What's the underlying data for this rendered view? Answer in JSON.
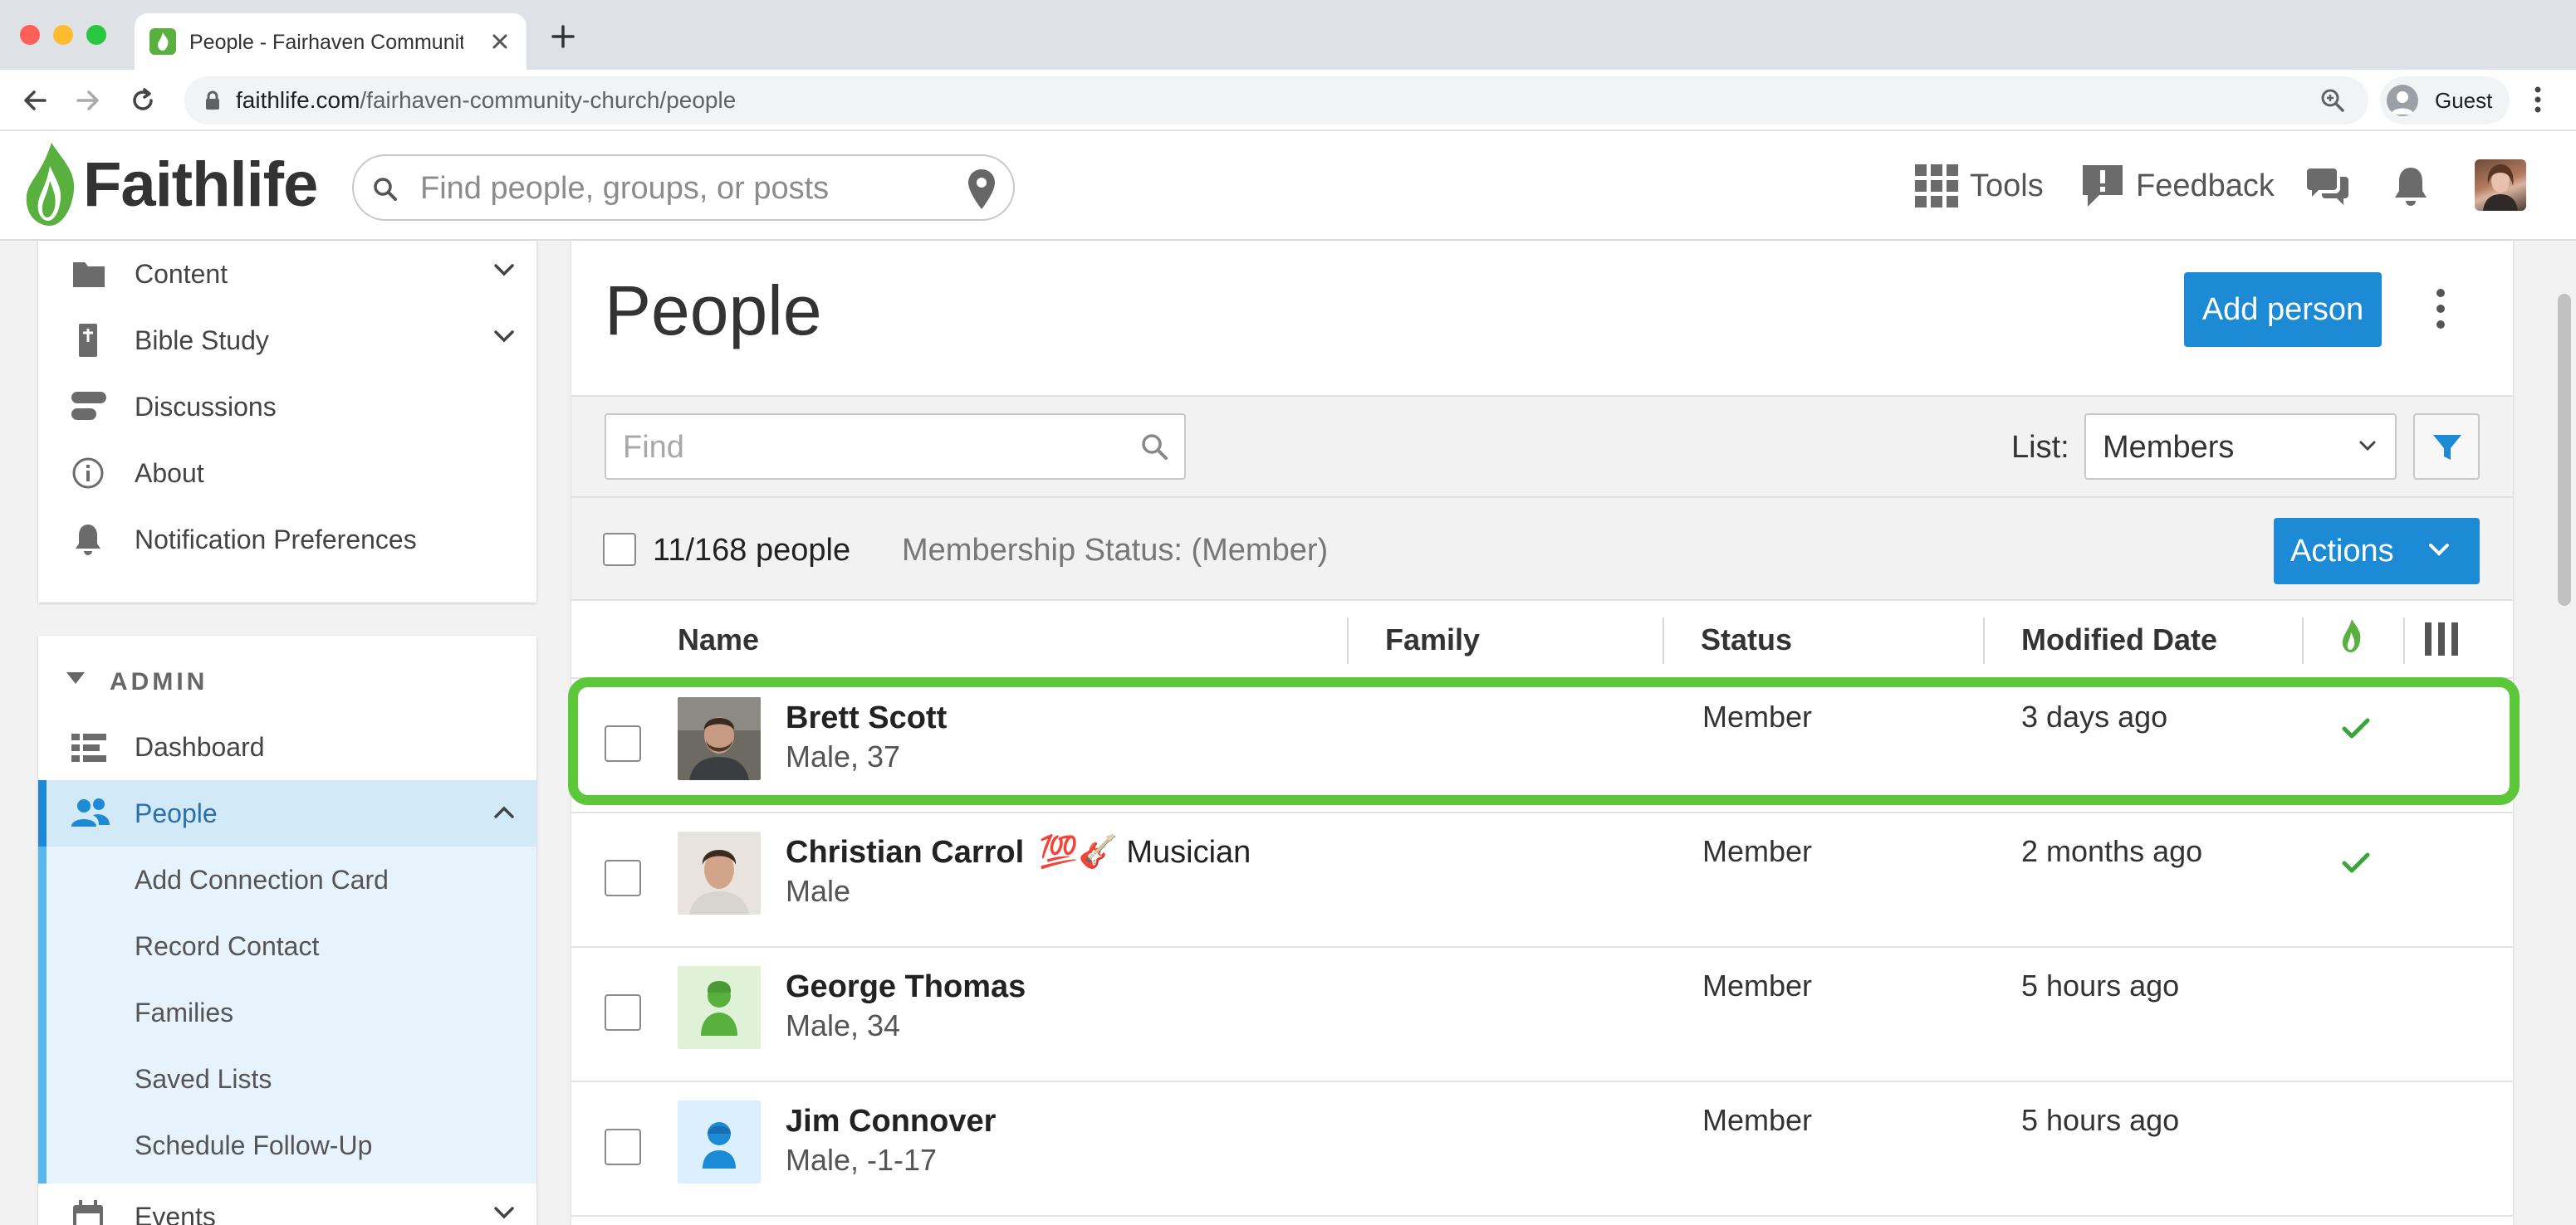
{
  "browser": {
    "tab_title": "People - Fairhaven Community Church",
    "url_host": "faithlife.com",
    "url_path": "/fairhaven-community-church/people",
    "profile_label": "Guest"
  },
  "header": {
    "logo_text": "Faithlife",
    "search_placeholder": "Find people, groups, or posts",
    "tools_label": "Tools",
    "feedback_label": "Feedback"
  },
  "sidebar": {
    "top_items": [
      {
        "label": "Content",
        "icon": "folder-icon"
      },
      {
        "label": "Bible Study",
        "icon": "bible-icon"
      },
      {
        "label": "Discussions",
        "icon": "discussions-icon"
      },
      {
        "label": "About",
        "icon": "info-icon"
      },
      {
        "label": "Notification Preferences",
        "icon": "bell-icon"
      }
    ],
    "admin_label": "ADMIN",
    "admin_items": [
      {
        "label": "Dashboard",
        "icon": "dashboard-icon"
      },
      {
        "label": "People",
        "icon": "people-icon"
      }
    ],
    "people_sub_items": [
      {
        "label": "Add Connection Card"
      },
      {
        "label": "Record Contact"
      },
      {
        "label": "Families"
      },
      {
        "label": "Saved Lists"
      },
      {
        "label": "Schedule Follow-Up"
      }
    ],
    "events_label": "Events"
  },
  "main": {
    "title": "People",
    "add_person_label": "Add person",
    "find_placeholder": "Find",
    "list_label": "List:",
    "list_value": "Members",
    "selection_count": "11/168 people",
    "filter_summary": "Membership Status: (Member)",
    "actions_label": "Actions",
    "columns": {
      "name": "Name",
      "family": "Family",
      "status": "Status",
      "modified": "Modified Date"
    },
    "rows": [
      {
        "name": "Brett Scott",
        "tag": "",
        "detail": "Male, 37",
        "status": "Member",
        "modified": "3 days ago",
        "faithlife_user": true
      },
      {
        "name": "Christian Carrol",
        "tag": "💯🎸 Musician",
        "detail": "Male",
        "status": "Member",
        "modified": "2 months ago",
        "faithlife_user": true
      },
      {
        "name": "George Thomas",
        "tag": "",
        "detail": "Male, 34",
        "status": "Member",
        "modified": "5 hours ago",
        "faithlife_user": false
      },
      {
        "name": "Jim Connover",
        "tag": "",
        "detail": "Male, -1-17",
        "status": "Member",
        "modified": "5 hours ago",
        "faithlife_user": false
      }
    ]
  },
  "colors": {
    "primary": "#1d8ad6",
    "brand_green": "#5ab03f",
    "highlight": "#5cc73a",
    "check_green": "#3aa63a"
  }
}
